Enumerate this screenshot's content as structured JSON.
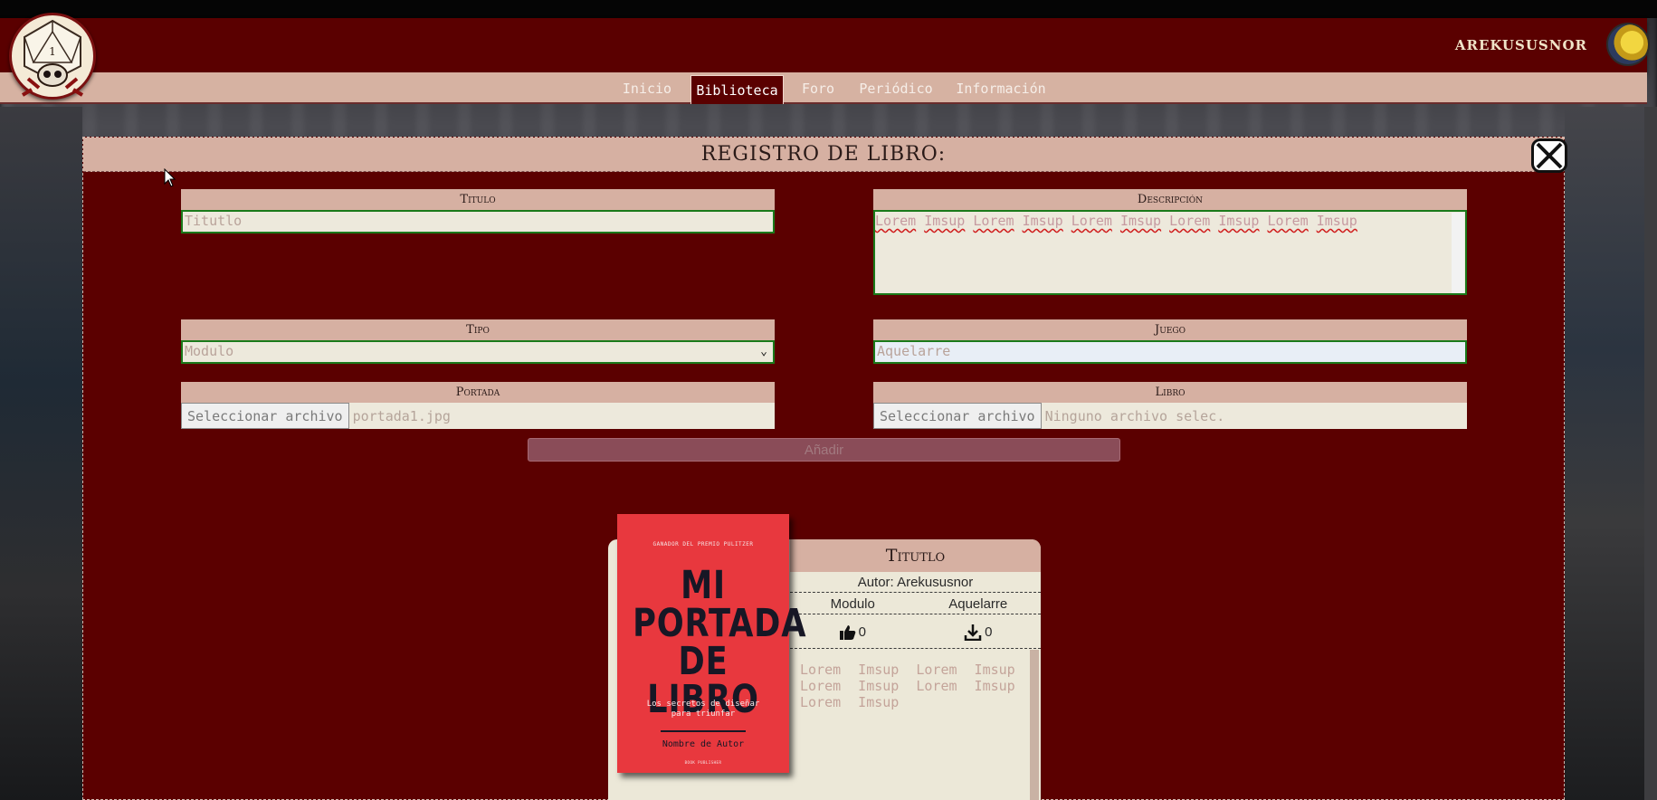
{
  "header": {
    "username": "AREKUSUSNOR",
    "logo_number": "1"
  },
  "nav": {
    "items": [
      {
        "label": "Inicio",
        "active": false
      },
      {
        "label": "Biblioteca",
        "active": true
      },
      {
        "label": "Foro",
        "active": false
      },
      {
        "label": "Periódico",
        "active": false
      },
      {
        "label": "Información",
        "active": false
      }
    ]
  },
  "modal": {
    "title": "REGISTRO DE LIBRO:",
    "fields": {
      "titulo": {
        "label": "Titulo",
        "value": "Titutlo"
      },
      "descripcion": {
        "label": "Descripción",
        "words": [
          "Lorem",
          "Imsup",
          "Lorem",
          "Imsup",
          "Lorem",
          "Imsup",
          "Lorem",
          "Imsup",
          "Lorem",
          "Imsup"
        ]
      },
      "tipo": {
        "label": "Tipo",
        "value": "Modulo"
      },
      "juego": {
        "label": "Juego",
        "value": "Aquelarre"
      },
      "portada": {
        "label": "Portada",
        "button": "Seleccionar archivo",
        "file": "portada1.jpg"
      },
      "libro": {
        "label": "Libro",
        "button": "Seleccionar archivo",
        "file": "Ninguno archivo selec."
      }
    },
    "submit_label": "Añadir"
  },
  "preview": {
    "title": "Titutlo",
    "author": "Autor: Arekususnor",
    "type": "Modulo",
    "game": "Aquelarre",
    "likes": "0",
    "downloads": "0",
    "description": "Lorem Imsup Lorem Imsup Lorem Imsup Lorem Imsup Lorem Imsup",
    "cover": {
      "award": "GANADOR DEL PREMIO PULITZER",
      "title_lines": [
        "MI",
        "PORTADA",
        "DE LIBRO"
      ],
      "subtitle": "Los secretos de diseñar para triunfar",
      "author": "Nombre de Autor",
      "publisher": "BOOK PUBLISHER"
    }
  },
  "colors": {
    "header": "#5a0000",
    "panel": "#d6b0a2",
    "field_border": "#1a7a1a",
    "cover": "#e8383e"
  }
}
